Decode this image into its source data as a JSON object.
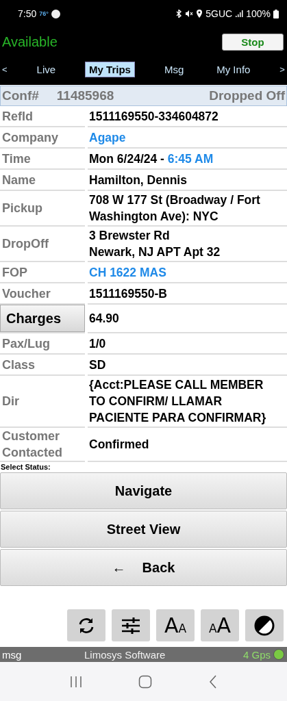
{
  "status_bar": {
    "time": "7:50",
    "temperature": "76°",
    "network": "5GUC",
    "battery": "100%"
  },
  "header": {
    "status": "Available",
    "button": "Stop"
  },
  "tabs": {
    "prev": "<",
    "next": ">",
    "items": [
      {
        "label": "Live",
        "selected": false
      },
      {
        "label": "My Trips",
        "selected": true
      },
      {
        "label": "Msg",
        "selected": false
      },
      {
        "label": "My Info",
        "selected": false
      }
    ]
  },
  "trip": {
    "conf_label": "Conf#",
    "conf_number": "11485968",
    "state": "Dropped Off",
    "rows": [
      {
        "label": "RefId",
        "kind": "text",
        "value": "1511169550-334604872"
      },
      {
        "label": "Company",
        "kind": "link",
        "value": "Agape"
      },
      {
        "label": "Time",
        "kind": "text",
        "value": "Mon 6/24/24 - ",
        "accent": "6:45 AM"
      },
      {
        "label": "Name",
        "kind": "text",
        "value": "Hamilton, Dennis"
      },
      {
        "label": "Pickup",
        "kind": "text",
        "value": "708 W 177 St (Broadway / Fort Washington Ave): NYC"
      },
      {
        "label": "DropOff",
        "kind": "text",
        "value": "3 Brewster Rd\nNewark, NJ APT Apt 32"
      },
      {
        "label": "FOP",
        "kind": "link",
        "value": "CH 1622 MAS"
      },
      {
        "label": "Voucher",
        "kind": "text",
        "value": "1511169550-B"
      },
      {
        "label": "Charges",
        "kind": "button",
        "value": "64.90"
      },
      {
        "label": "Pax/Lug",
        "kind": "text",
        "value": "1/0"
      },
      {
        "label": "Class",
        "kind": "text",
        "value": "SD"
      },
      {
        "label": "Dir",
        "kind": "text",
        "value": "{Acct:PLEASE CALL MEMBER TO CONFIRM/ LLAMAR PACIENTE PARA CONFIRMAR}"
      },
      {
        "label": "Customer Contacted",
        "kind": "text",
        "value": "Confirmed"
      }
    ]
  },
  "select_status_label": "Select Status:",
  "actions": [
    {
      "label": "Navigate",
      "kind": "plain"
    },
    {
      "label": "Street View",
      "kind": "plain"
    },
    {
      "label": "Back",
      "kind": "back",
      "arrow": "←"
    }
  ],
  "tools": [
    {
      "kind": "refresh"
    },
    {
      "kind": "settings"
    },
    {
      "kind": "font-smaller",
      "big": "A",
      "small": "A"
    },
    {
      "kind": "font-larger",
      "big": "A",
      "small": "A"
    },
    {
      "kind": "contrast"
    }
  ],
  "footer": {
    "left": "msg",
    "center": "Limosys Software",
    "gps": "4 Gps",
    "gps_dot": {
      "color": "#7ac943"
    }
  }
}
